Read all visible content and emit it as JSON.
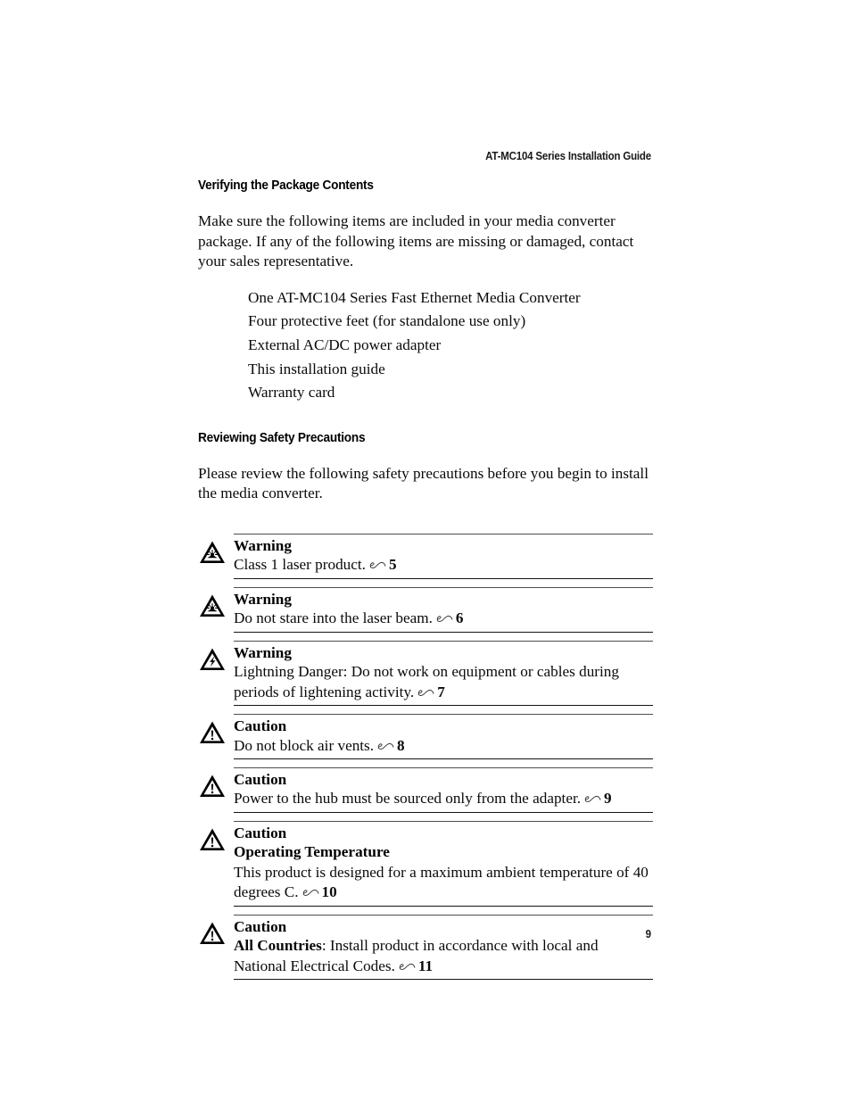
{
  "document": {
    "running_header": "AT-MC104 Series Installation Guide",
    "page_number": "9"
  },
  "sections": [
    {
      "heading": "Verifying the Package Contents",
      "paragraph": "Make sure the following items are included in your media converter package. If any of the following items are missing or damaged, contact your sales representative.",
      "list": [
        "One AT-MC104 Series Fast Ethernet Media Converter",
        "Four protective feet (for standalone use only)",
        "External AC/DC power adapter",
        "This installation guide",
        "Warranty card"
      ]
    },
    {
      "heading": "Reviewing Safety Precautions",
      "paragraph": "Please review the following safety precautions before you begin to install the media converter."
    }
  ],
  "admonitions": [
    {
      "icon": "laser-warning-triangle-icon",
      "title": "Warning",
      "subtitle": "",
      "lead": "",
      "text": "Class 1 laser product.",
      "ref_page": "5"
    },
    {
      "icon": "laser-warning-triangle-icon",
      "title": "Warning",
      "subtitle": "",
      "lead": "",
      "text": "Do not stare into the laser beam.",
      "ref_page": "6"
    },
    {
      "icon": "lightning-warning-triangle-icon",
      "title": "Warning",
      "subtitle": "",
      "lead": "",
      "text": "Lightning Danger: Do not work on equipment or cables during periods of lightening activity.",
      "ref_page": "7"
    },
    {
      "icon": "exclamation-caution-triangle-icon",
      "title": "Caution",
      "subtitle": "",
      "lead": "",
      "text": "Do not block air vents.",
      "ref_page": "8"
    },
    {
      "icon": "exclamation-caution-triangle-icon",
      "title": "Caution",
      "subtitle": "",
      "lead": "",
      "text": "Power to the hub must be sourced only from the adapter.",
      "ref_page": "9"
    },
    {
      "icon": "exclamation-caution-triangle-icon",
      "title": "Caution",
      "subtitle": "Operating Temperature",
      "lead": "",
      "text": "This product is designed for a maximum ambient temperature of 40 degrees C.",
      "ref_page": "10"
    },
    {
      "icon": "exclamation-caution-triangle-icon",
      "title": "Caution",
      "subtitle": "",
      "lead": "All Countries",
      "text": ": Install product in accordance with local and National Electrical Codes.",
      "ref_page": "11"
    }
  ],
  "colors": {
    "text": "#0a0a0a",
    "rule_top": "#4e4e4e",
    "rule_bottom": "#141414",
    "page_background": "#ffffff"
  }
}
